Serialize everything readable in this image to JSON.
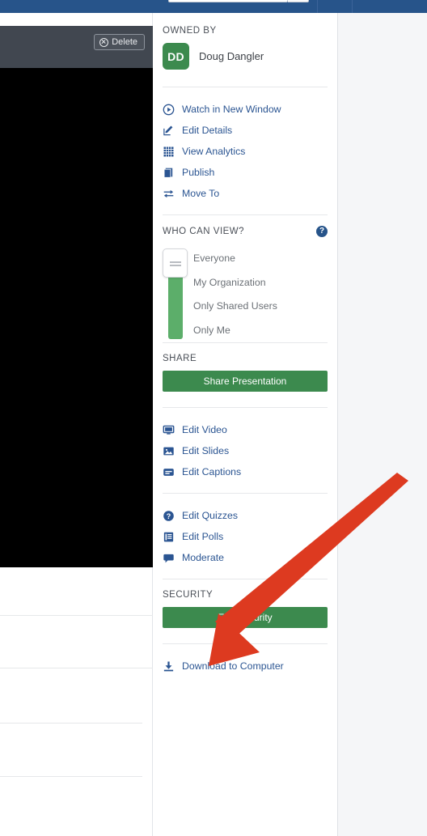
{
  "colors": {
    "topbar": "#27548a",
    "accent_green": "#3c8a4e",
    "link_blue": "#2b5592",
    "annotation_red": "#dd3a20",
    "slider_green": "#5cae6a",
    "page_bg": "#f5f6f8"
  },
  "topbar": {
    "search_value": "",
    "search_placeholder": ""
  },
  "player": {
    "delete_label": "Delete",
    "delete_icon": "circle-x-icon"
  },
  "sidebar": {
    "owned_by": {
      "heading": "OWNED BY",
      "avatar_initials": "DD",
      "name": "Doug Dangler"
    },
    "actions": [
      {
        "label": "Watch in New Window",
        "icon": "play-circle-icon"
      },
      {
        "label": "Edit Details",
        "icon": "edit-pencil-icon"
      },
      {
        "label": "View Analytics",
        "icon": "analytics-grid-icon"
      },
      {
        "label": "Publish",
        "icon": "publish-book-icon"
      },
      {
        "label": "Move To",
        "icon": "move-arrows-icon"
      }
    ],
    "who_can_view": {
      "heading": "WHO CAN VIEW?",
      "help_icon": "help-circle-icon",
      "help_label": "?",
      "options": [
        "Everyone",
        "My Organization",
        "Only Shared Users",
        "Only Me"
      ],
      "selected": "Everyone"
    },
    "share": {
      "heading": "SHARE",
      "button_label": "Share Presentation"
    },
    "edit_actions": [
      {
        "label": "Edit Video",
        "icon": "monitor-icon"
      },
      {
        "label": "Edit Slides",
        "icon": "image-icon"
      },
      {
        "label": "Edit Captions",
        "icon": "captions-icon"
      }
    ],
    "interaction_actions": [
      {
        "label": "Edit Quizzes",
        "icon": "question-circle-icon"
      },
      {
        "label": "Edit Polls",
        "icon": "poll-list-icon"
      },
      {
        "label": "Moderate",
        "icon": "comment-bubble-icon"
      }
    ],
    "security": {
      "heading": "SECURITY",
      "button_label": "Edit Security"
    },
    "download": {
      "label": "Download to Computer",
      "icon": "download-icon"
    }
  }
}
